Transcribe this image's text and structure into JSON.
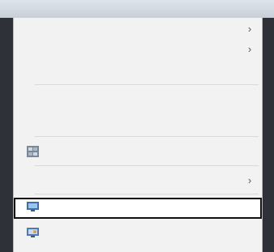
{
  "window": {
    "title": ""
  },
  "menu": {
    "items": [
      {
        "label": "",
        "has_submenu": true,
        "disabled": false,
        "icon": ""
      },
      {
        "label": "",
        "has_submenu": true,
        "disabled": false,
        "icon": ""
      },
      {
        "label": "",
        "has_submenu": false,
        "disabled": false,
        "icon": ""
      },
      {
        "label": "",
        "has_submenu": false,
        "disabled": true,
        "icon": ""
      },
      {
        "label": "",
        "has_submenu": false,
        "disabled": true,
        "icon": ""
      },
      {
        "label": "",
        "has_submenu": false,
        "disabled": false,
        "icon": "graphics-settings-icon"
      },
      {
        "label": "",
        "has_submenu": true,
        "disabled": false,
        "icon": ""
      },
      {
        "label": "",
        "has_submenu": false,
        "disabled": false,
        "icon": "display-settings-icon",
        "highlighted": true
      },
      {
        "label": "",
        "has_submenu": false,
        "disabled": false,
        "icon": "personalize-icon"
      }
    ]
  },
  "colors": {
    "highlight_border": "#111111",
    "menu_background": "#f2f2f2",
    "disabled_text": "#9a9a9a"
  }
}
